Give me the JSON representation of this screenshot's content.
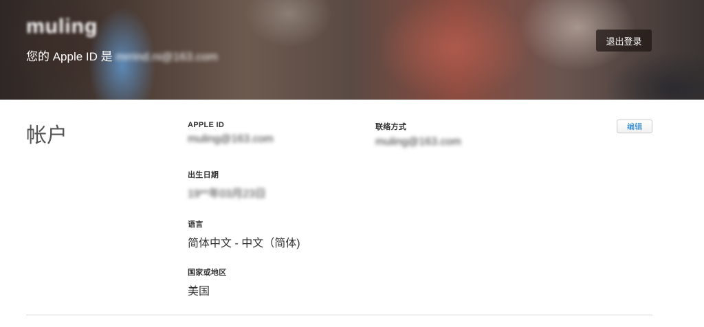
{
  "header": {
    "user_name": "muling",
    "apple_id_prefix": "您的 Apple ID 是 ",
    "apple_id_email": "mrrind.ni@163.com",
    "signout_label": "退出登录"
  },
  "account": {
    "section_title": "帐户",
    "edit_label": "编辑",
    "apple_id": {
      "label": "APPLE ID",
      "value": "muling@163.com"
    },
    "contact": {
      "label": "联络方式",
      "value": "muling@163.com"
    },
    "birthday": {
      "label": "出生日期",
      "value": "19**年03月23日"
    },
    "language": {
      "label": "语言",
      "value": "简体中文 - 中文（简体)"
    },
    "region": {
      "label": "国家或地区",
      "value": "美国"
    }
  }
}
